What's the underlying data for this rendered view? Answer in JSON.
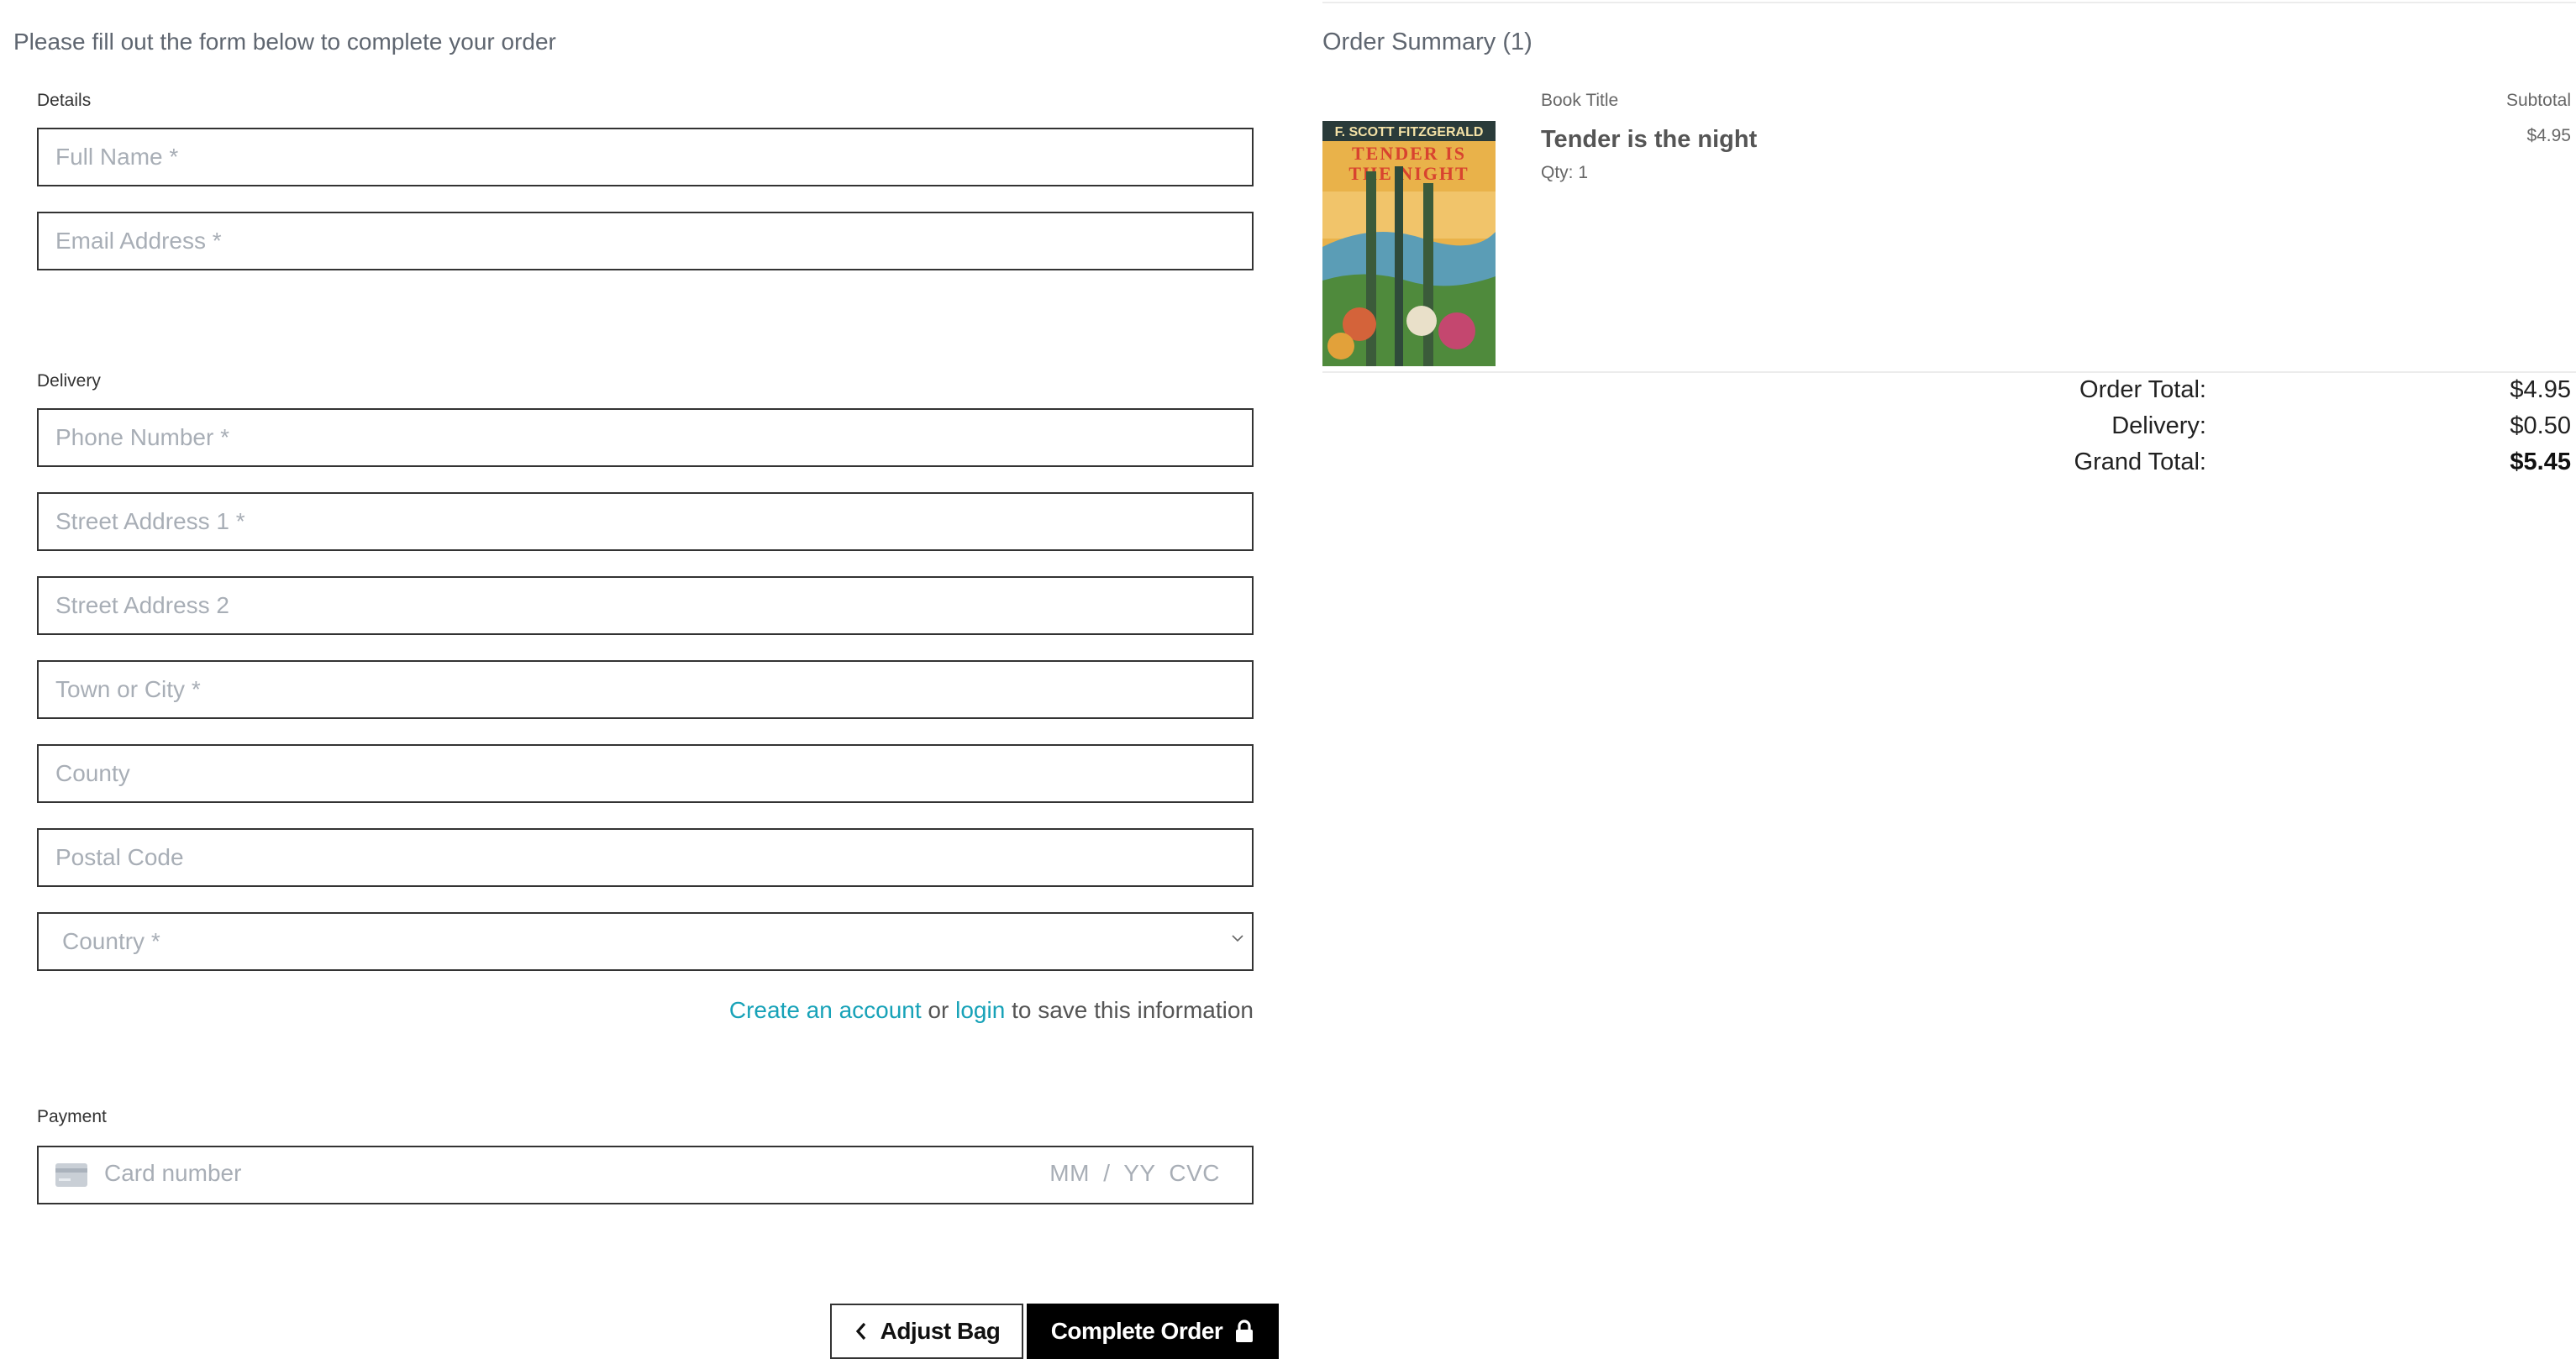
{
  "intro_text": "Please fill out the form below to complete your order",
  "form": {
    "details_label": "Details",
    "full_name_placeholder": "Full Name *",
    "email_placeholder": "Email Address *",
    "delivery_label": "Delivery",
    "phone_placeholder": "Phone Number *",
    "street1_placeholder": "Street Address 1 *",
    "street2_placeholder": "Street Address 2",
    "town_placeholder": "Town or City *",
    "county_placeholder": "County",
    "postal_placeholder": "Postal Code",
    "country_placeholder": "Country *",
    "create_account_link": "Create an account",
    "or_text": " or ",
    "login_link": "login",
    "save_info_text": " to save this information",
    "payment_label": "Payment",
    "card_number_placeholder": "Card number",
    "card_expiry_cvc_placeholder": "MM / YY  CVC"
  },
  "buttons": {
    "adjust_bag": "Adjust Bag",
    "complete_order": "Complete Order"
  },
  "summary": {
    "title": "Order Summary (1)",
    "col_book_title": "Book Title",
    "col_subtotal": "Subtotal",
    "item": {
      "title": "Tender is the night",
      "qty": "Qty: 1",
      "subtotal": "$4.95",
      "cover_author": "F. SCOTT FITZGERALD",
      "cover_title_line1": "TENDER IS",
      "cover_title_line2": "THE NIGHT"
    },
    "order_total_label": "Order Total:",
    "order_total_value": "$4.95",
    "delivery_label": "Delivery:",
    "delivery_value": "$0.50",
    "grand_total_label": "Grand Total:",
    "grand_total_value": "$5.45"
  },
  "colors": {
    "link": "#17a2b8",
    "primary_button": "#000000",
    "border": "#333333",
    "placeholder": "#a8aeb6"
  }
}
